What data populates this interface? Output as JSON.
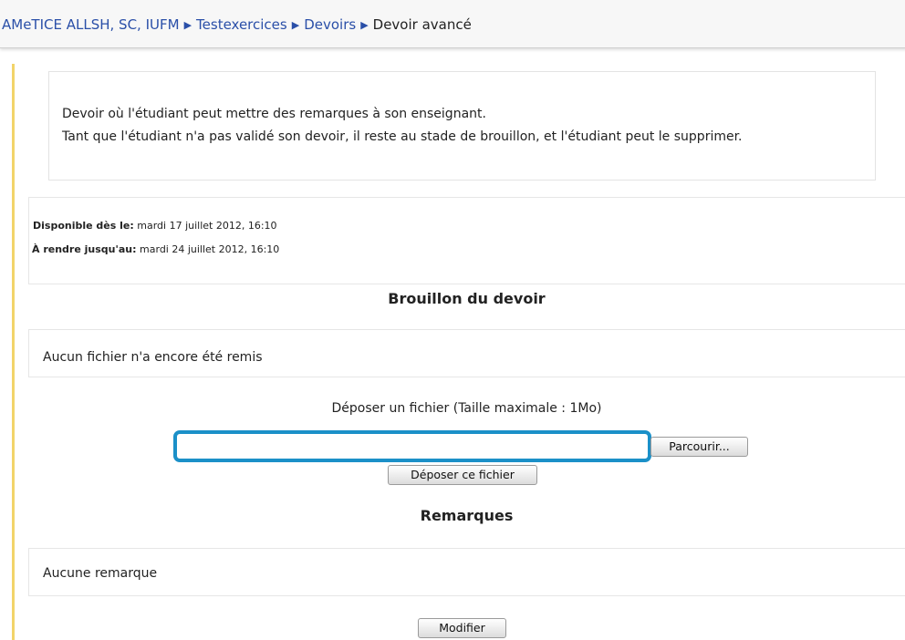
{
  "breadcrumb": {
    "items": [
      "AMeTICE ALLSH, SC, IUFM",
      "Testexercices",
      "Devoirs"
    ],
    "current": "Devoir avancé"
  },
  "description": {
    "line1": "Devoir où l'étudiant peut mettre des remarques à son enseignant.",
    "line2": "Tant que l'étudiant n'a pas validé son devoir, il reste au stade de brouillon, et l'étudiant peut le supprimer."
  },
  "dates": {
    "available_label": "Disponible dès le:",
    "available_value": "mardi 17 juillet 2012, 16:10",
    "due_label": "À rendre jusqu'au:",
    "due_value": "mardi 24 juillet 2012, 16:10"
  },
  "draft": {
    "title": "Brouillon du devoir",
    "status": "Aucun fichier n'a encore été remis",
    "upload_label": "Déposer un fichier (Taille maximale : 1Mo)",
    "file_value": "",
    "browse_label": "Parcourir...",
    "submit_label": "Déposer ce fichier"
  },
  "remarks": {
    "title": "Remarques",
    "status": "Aucune remarque",
    "edit_label": "Modifier"
  },
  "colors": {
    "link": "#2a4fa8",
    "highlight_border": "#1b90c8",
    "side_bar": "#f2d46a"
  }
}
